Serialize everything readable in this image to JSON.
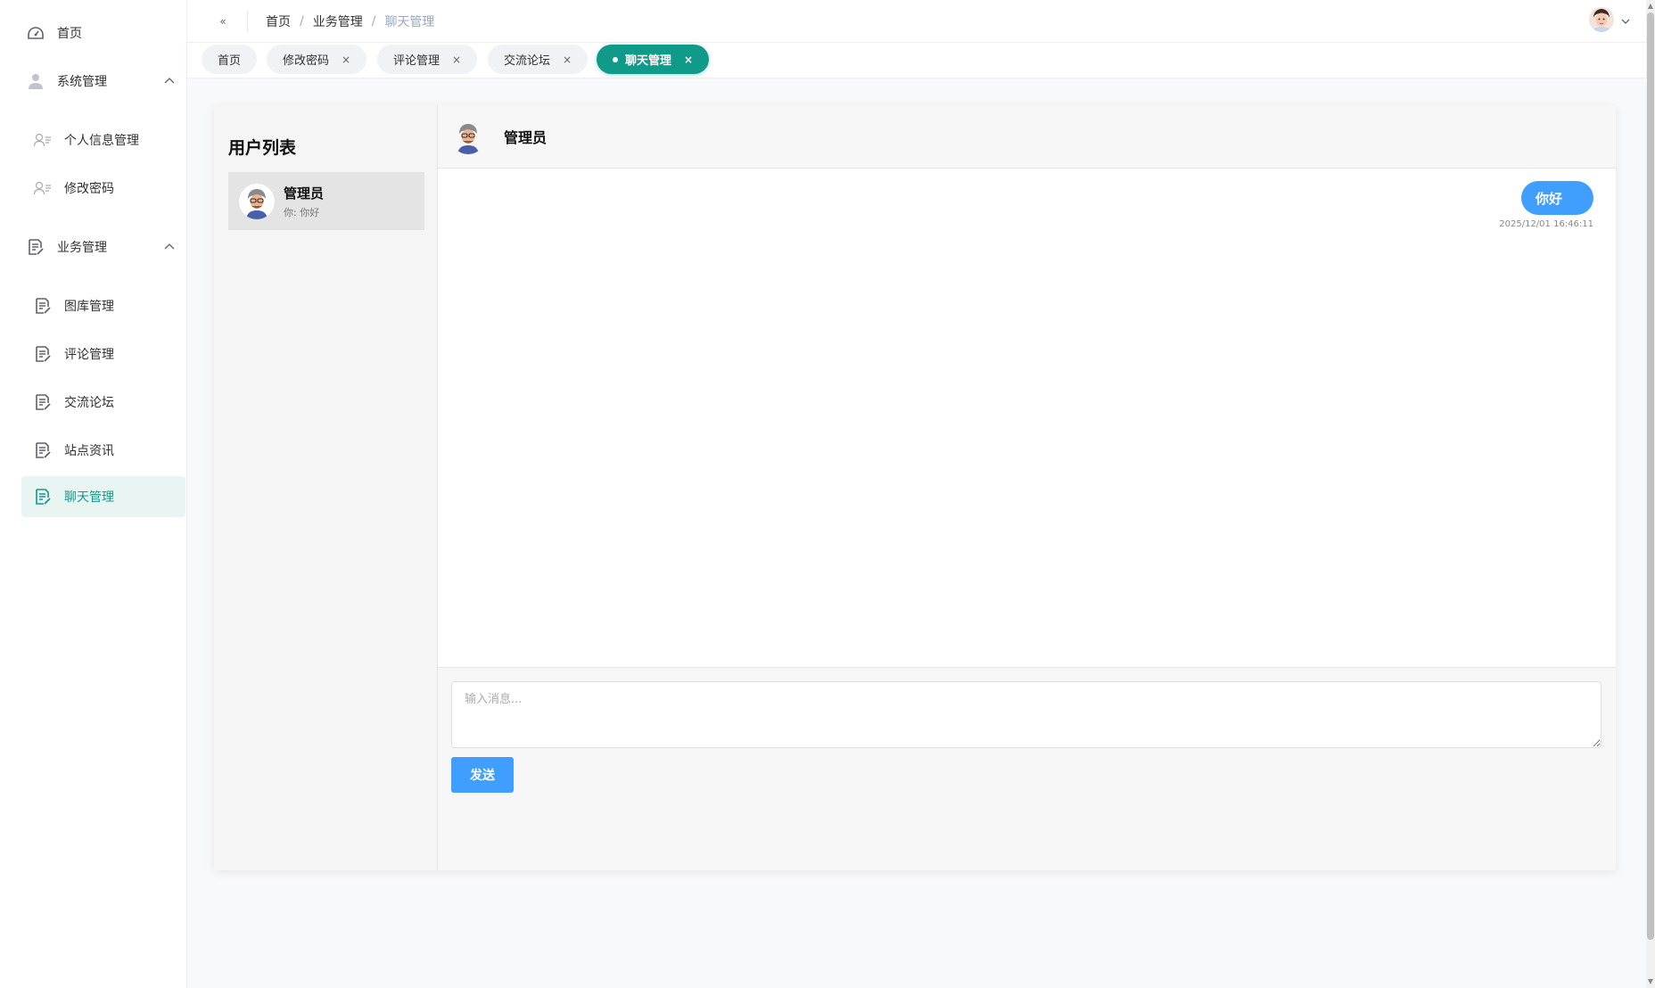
{
  "sidebar": {
    "items": [
      {
        "label": "首页",
        "icon": "dashboard-icon"
      },
      {
        "label": "系统管理",
        "icon": "user-icon"
      },
      {
        "label": "个人信息管理",
        "icon": "user-list-icon"
      },
      {
        "label": "修改密码",
        "icon": "user-list-icon"
      },
      {
        "label": "业务管理",
        "icon": "document-edit-icon"
      },
      {
        "label": "图库管理",
        "icon": "document-edit-icon"
      },
      {
        "label": "评论管理",
        "icon": "document-edit-icon"
      },
      {
        "label": "交流论坛",
        "icon": "document-edit-icon"
      },
      {
        "label": "站点资讯",
        "icon": "document-edit-icon"
      },
      {
        "label": "聊天管理",
        "icon": "document-edit-icon"
      }
    ],
    "active_index": 9
  },
  "header": {
    "collapse_icon": "«",
    "breadcrumb": [
      "首页",
      "业务管理",
      "聊天管理"
    ],
    "separator": "/"
  },
  "tags": [
    {
      "label": "首页",
      "closable": false
    },
    {
      "label": "修改密码",
      "closable": true
    },
    {
      "label": "评论管理",
      "closable": true
    },
    {
      "label": "交流论坛",
      "closable": true
    },
    {
      "label": "聊天管理",
      "closable": true,
      "active": true
    }
  ],
  "tag_close_glyph": "×",
  "chat": {
    "list_title": "用户列表",
    "users": [
      {
        "name": "管理员",
        "last_message": "你: 你好"
      }
    ],
    "current_user": "管理员",
    "messages": [
      {
        "text": "你好",
        "time": "2025/12/01 16:46:11",
        "from_self": true
      }
    ],
    "input_placeholder": "输入消息...",
    "send_label": "发送"
  },
  "colors": {
    "accent": "#0f9a8a",
    "primary": "#409eff",
    "active_menu_bg": "#e8f5f3"
  }
}
